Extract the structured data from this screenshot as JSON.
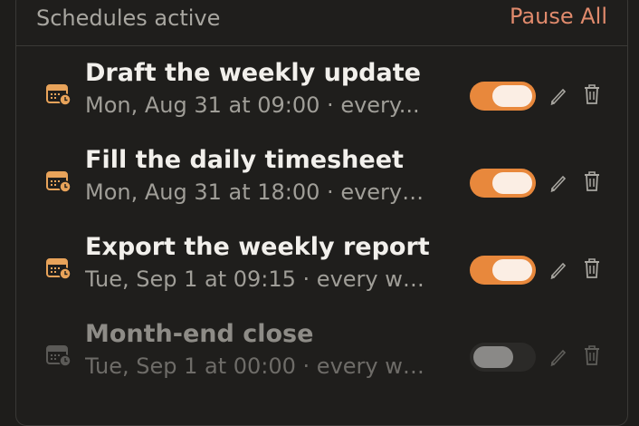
{
  "header": {
    "title": "Schedules active",
    "pause_all_label": "Pause All"
  },
  "colors": {
    "accent": "#e8883c",
    "pause_all": "#e08a6c",
    "toggle_knob_on": "#fbeee4",
    "toggle_knob_off": "#8a8987"
  },
  "schedules": [
    {
      "title": "Draft the weekly update",
      "subtitle": "Mon, Aug 31 at 09:00 · every...",
      "enabled": true,
      "icon": "calendar-clock-icon"
    },
    {
      "title": "Fill the daily timesheet",
      "subtitle": "Mon, Aug 31 at 18:00 · every d...",
      "enabled": true,
      "icon": "calendar-clock-icon"
    },
    {
      "title": "Export the weekly report",
      "subtitle": "Tue, Sep 1 at 09:15 · every week",
      "enabled": true,
      "icon": "calendar-clock-icon"
    },
    {
      "title": "Month-end close",
      "subtitle": "Tue, Sep 1 at 00:00 · every we...",
      "enabled": false,
      "icon": "calendar-clock-icon"
    }
  ]
}
